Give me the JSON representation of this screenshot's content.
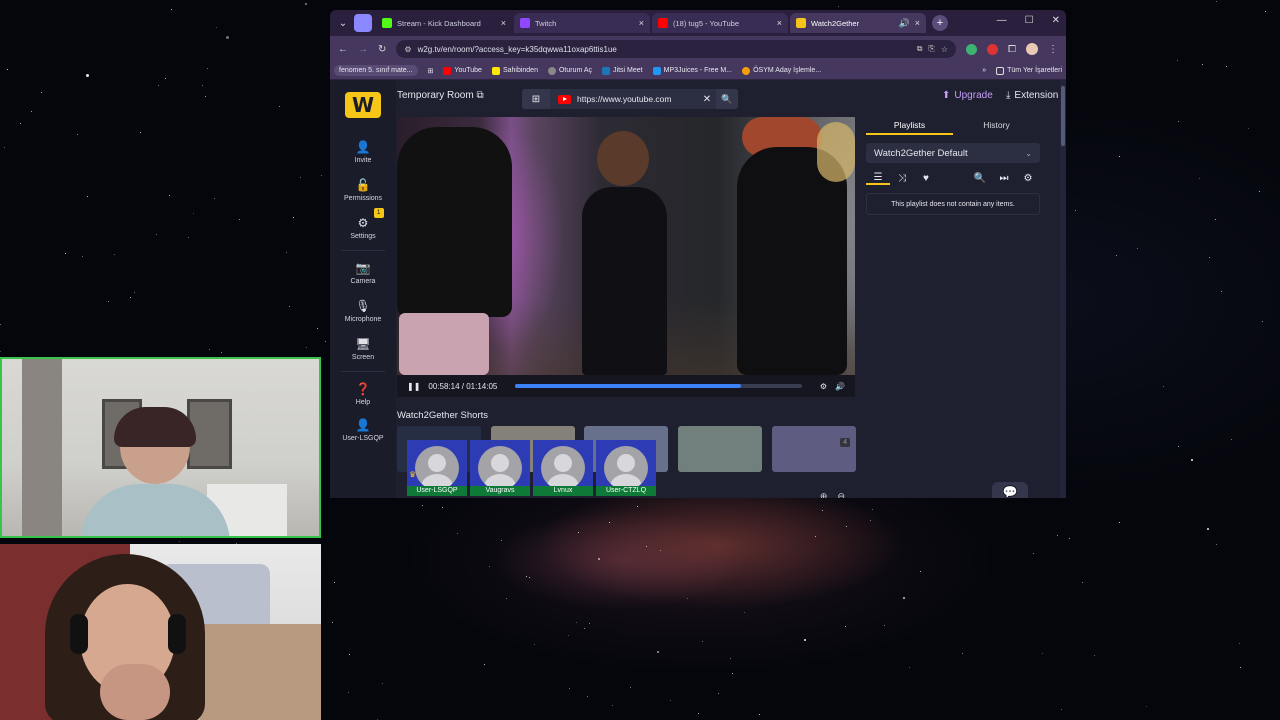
{
  "browser": {
    "tabs": [
      {
        "title": "Stream - Kick Dashboard",
        "favicon_color": "#53fc18",
        "active": false
      },
      {
        "title": "Twitch",
        "favicon_color": "#9146ff",
        "active": false
      },
      {
        "title": "(18) tug5 - YouTube",
        "favicon_color": "#ff0000",
        "active": false
      },
      {
        "title": "Watch2Gether",
        "favicon_color": "#f5c518",
        "active": true
      }
    ],
    "url": "w2g.tv/en/room/?access_key=k35dqwwa11oxap6ttis1ue",
    "bookmarks": [
      {
        "label": "fenomen 5. sınıf mate...",
        "color": "#594b74"
      },
      {
        "label": "YouTube",
        "color": "#ff0000"
      },
      {
        "label": "Sahibinden",
        "color": "#ffe800"
      },
      {
        "label": "Oturum Aç",
        "color": "#888888"
      },
      {
        "label": "Jitsi Meet",
        "color": "#1d76ba"
      },
      {
        "label": "MP3Juices - Free M...",
        "color": "#2196f3"
      },
      {
        "label": "ÖSYM Aday İşlemle...",
        "color": "#f59e0b"
      }
    ],
    "bookmarks_folder": "Tüm Yer İşaretleri"
  },
  "room": {
    "title": "Temporary Room",
    "search_value": "https://www.youtube.com",
    "upgrade_label": "Upgrade",
    "extension_label": "Extension",
    "sidebar": [
      {
        "label": "Invite",
        "icon": "add-user-icon"
      },
      {
        "label": "Permissions",
        "icon": "unlock-icon"
      },
      {
        "label": "Settings",
        "icon": "gear-icon",
        "badge": "1"
      },
      {
        "label": "Camera",
        "icon": "camera-icon"
      },
      {
        "label": "Microphone",
        "icon": "microphone-icon"
      },
      {
        "label": "Screen",
        "icon": "monitor-icon"
      },
      {
        "label": "Help",
        "icon": "help-icon"
      },
      {
        "label": "User-LSGQP",
        "icon": "user-icon"
      }
    ]
  },
  "player": {
    "time": "00:58:14 / 01:14:05",
    "progress": 0.786
  },
  "shorts": {
    "title": "Watch2Gether Shorts",
    "badge": "4",
    "users": [
      "User-LSGQP",
      "Vaugravs",
      "Lvnux",
      "User-CTZLQ"
    ]
  },
  "playlist": {
    "tabs": [
      "Playlists",
      "History"
    ],
    "selected": "Watch2Gether Default",
    "empty_message": "This playlist does not contain any items."
  },
  "colors": {
    "accent": "#f5c518",
    "progress": "#3b82f6",
    "upgrade": "#c89cf7",
    "user_tile": "#2d3bb5",
    "user_name_bar": "#0f7a38",
    "cam_border": "#36c54a"
  }
}
